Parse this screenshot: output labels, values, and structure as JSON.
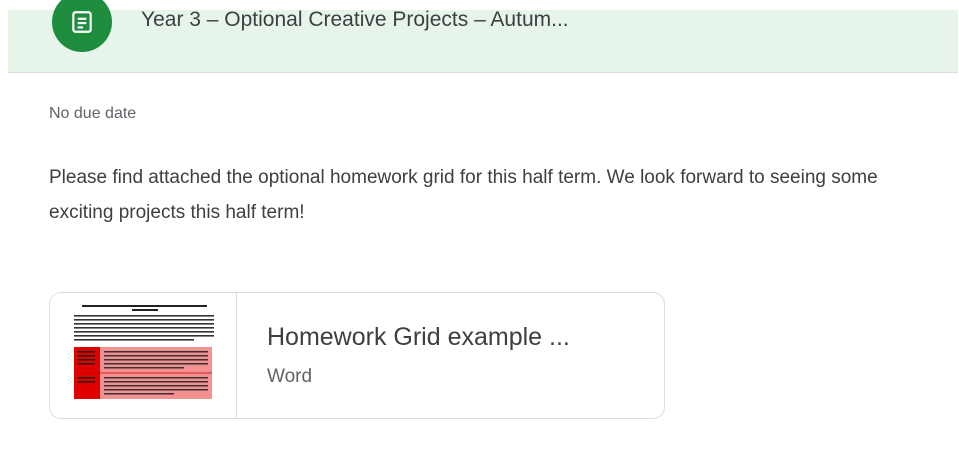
{
  "header": {
    "title": "Year 3 – Optional Creative Projects – Autum...",
    "icon": "assignment-icon",
    "accent_color": "#1e8e3e",
    "background_color": "#e6f4ea"
  },
  "assignment": {
    "due_date": "No due date",
    "description": "Please find attached the optional homework grid for this half term. We look forward to seeing some exciting projects this half term!"
  },
  "attachment": {
    "title": "Homework Grid example ...",
    "type": "Word",
    "thumbnail_icon": "document-preview-icon"
  }
}
